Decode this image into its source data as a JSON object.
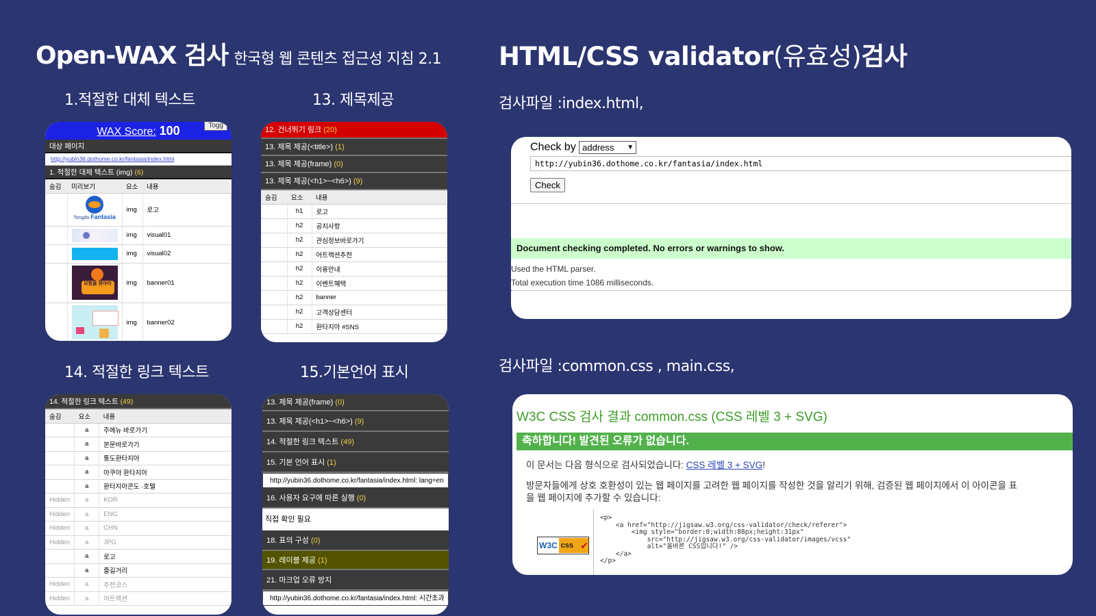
{
  "left": {
    "title": "Open-WAX 검사",
    "subtitle": "한국형 웹 콘텐츠 접근성 지침 2.1",
    "captions": [
      "1.적절한 대체 텍스트",
      "13. 제목제공",
      "14. 적절한 링크 텍스트",
      "15.기본언어 표시"
    ],
    "panel_a": {
      "score_label": "WAX Score:",
      "score_value": "100",
      "toggle": "Togg",
      "target_label": "대상 페이지",
      "url": "http://yubin36.dothome.co.kr/fantasia/index.html",
      "section_label": "1. 적절한 대체 텍스트 (img)",
      "section_count": "(6)",
      "headers": [
        "숨김",
        "미리보기",
        "요소",
        "내용"
      ],
      "rows": [
        {
          "el": "img",
          "content": "로고"
        },
        {
          "el": "img",
          "content": "visual01"
        },
        {
          "el": "img",
          "content": "visual02"
        },
        {
          "el": "img",
          "content": "banner01"
        },
        {
          "el": "img",
          "content": "banner02"
        }
      ],
      "logo_text": "Tongdo",
      "logo_brand": "Fantasia",
      "banner_text": "모험을 찾아라"
    },
    "panel_b": {
      "rows": [
        {
          "label": "12. 건너뛰기 링크",
          "count": "(20)"
        },
        {
          "label": "13. 제목 제공(<title>)",
          "count": "(1)"
        },
        {
          "label": "13. 제목 제공(frame)",
          "count": "(0)"
        },
        {
          "label": "13. 제목 제공(<h1>~<h6>)",
          "count": "(9)"
        }
      ],
      "headers": [
        "숨김",
        "요소",
        "내용"
      ],
      "items": [
        {
          "el": "h1",
          "content": "로고"
        },
        {
          "el": "h2",
          "content": "공지사항"
        },
        {
          "el": "h2",
          "content": "관심정보바로가기"
        },
        {
          "el": "h2",
          "content": "어트랙션추천"
        },
        {
          "el": "h2",
          "content": "이용안내"
        },
        {
          "el": "h2",
          "content": "이벤트혜택"
        },
        {
          "el": "h2",
          "content": "banner"
        },
        {
          "el": "h2",
          "content": "고객상담센터"
        },
        {
          "el": "h2",
          "content": "환타지아 #SNS"
        }
      ]
    },
    "panel_c": {
      "section_label": "14. 적절한 링크 텍스트",
      "section_count": "(49)",
      "headers": [
        "숨김",
        "요소",
        "내용"
      ],
      "items": [
        {
          "hidden": "",
          "el": "a",
          "content": "주메뉴 바로가기"
        },
        {
          "hidden": "",
          "el": "a",
          "content": "본문바로가기"
        },
        {
          "hidden": "",
          "el": "a",
          "content": "통도환타지아"
        },
        {
          "hidden": "",
          "el": "a",
          "content": "아쿠아 환타지아"
        },
        {
          "hidden": "",
          "el": "a",
          "content": "환타지아콘도 ·호텔"
        },
        {
          "hidden": "Hidden",
          "el": "a",
          "content": "KOR"
        },
        {
          "hidden": "Hidden",
          "el": "a",
          "content": "ENG"
        },
        {
          "hidden": "Hidden",
          "el": "a",
          "content": "CHN"
        },
        {
          "hidden": "Hidden",
          "el": "a",
          "content": "JPG"
        },
        {
          "hidden": "",
          "el": "a",
          "content": "로고"
        },
        {
          "hidden": "",
          "el": "a",
          "content": "즐길거리"
        },
        {
          "hidden": "Hidden",
          "el": "a",
          "content": "추천코스"
        },
        {
          "hidden": "Hidden",
          "el": "a",
          "content": "어트랙션"
        }
      ]
    },
    "panel_d": {
      "rows": [
        {
          "label": "13. 제목 제공(frame)",
          "count": "(0)"
        },
        {
          "label": "13. 제목 제공(<h1>~<h6>)",
          "count": "(9)"
        },
        {
          "label": "14. 적절한 링크 텍스트",
          "count": "(49)"
        },
        {
          "label": "15. 기본 언어 표시",
          "count": "(1)"
        },
        {
          "label": "16. 사용자 요구에 따른 실행",
          "count": "(0)"
        },
        {
          "label": "18. 표의 구성",
          "count": "(0)"
        },
        {
          "label": "19. 레이블 제공",
          "count": "(1)"
        },
        {
          "label": "21. 마크업 오류 방지",
          "count": ""
        }
      ],
      "lang_line": "http://yubin36.dothome.co.kr/fantasia/index.html: lang=en",
      "manual_check": "직접 확인 필요",
      "markup_line": "http://yubin36.dothome.co.kr/fantasia/index.html: 시간초과"
    }
  },
  "right": {
    "title_main": "HTML/CSS  validator",
    "title_paren": "(유효성)",
    "title_end": "검사",
    "file1_label": "검사파일 :index.html,",
    "file2_label": "검사파일 :common.css , main.css,",
    "validator": {
      "check_by": "Check by",
      "select_value": "address",
      "url": "http://yubin36.dothome.co.kr/fantasia/index.html",
      "button": "Check",
      "result": "Document checking completed. No errors or warnings to show.",
      "note1": "Used the HTML parser.",
      "note2": "Total execution time 1086 milliseconds."
    },
    "css_validator": {
      "title": "W3C CSS 검사 결과 common.css (CSS 레벨 3 + SVG)",
      "ok": "축하합니다! 발견된 오류가 없습니다.",
      "line1_pre": "이 문서는 다음 형식으로 검사되었습니다:",
      "line1_link": "CSS 레벨 3 + SVG",
      "line1_post": "!",
      "para1": "방문자들에게 상호 호환성이 있는 웹 페이지를 고려한 웹 페이지를 작성한 것을 알리기 위해, 검증된 웹 페이지에서 이 아이콘을 표",
      "para2": "을 웹 페이지에 추가할 수 있습니다:",
      "badge_w3c": "W3C",
      "badge_css": "css",
      "code": "<p>\n    <a href=\"http://jigsaw.w3.org/css-validator/check/referer\">\n        <img style=\"border:0;width:88px;height:31px\"\n            src=\"http://jigsaw.w3.org/css-validator/images/vcss\"\n            alt=\"올바른 CSS입니다!\" />\n    </a>\n</p>"
    }
  }
}
